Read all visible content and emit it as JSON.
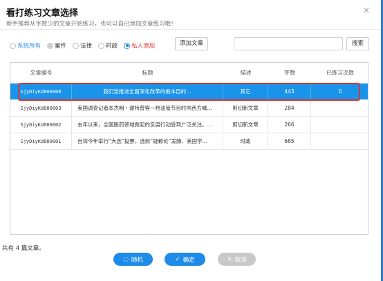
{
  "dialog": {
    "title": "看打练习文章选择",
    "subtitle": "新手推荐从字数少的文章开始练习，也可以自已添加文章练习哦！",
    "close_label": "×"
  },
  "filters": {
    "options": [
      {
        "label": "系统所有",
        "state": "selected-empty",
        "color": "#2f8fe6"
      },
      {
        "label": "案件",
        "state": "grey"
      },
      {
        "label": "法律",
        "state": "empty"
      },
      {
        "label": "时政",
        "state": "empty"
      },
      {
        "label": "私人添加",
        "state": "selected",
        "color": "#e23a3a"
      }
    ],
    "add_article_label": "添加文章",
    "search_placeholder": "",
    "search_value": "",
    "search_button_label": "搜索"
  },
  "table": {
    "headers": [
      "文章编号",
      "标题",
      "描述",
      "字数",
      "已练习次数"
    ],
    "rows": [
      {
        "id": "SjyDiyKd000008",
        "title": "我们党推进全面深化改革的根本目的…",
        "desc": "其它",
        "words": "443",
        "practiced": "0",
        "selected": true
      },
      {
        "id": "SjyDiyKd000003",
        "title": "美国调查记者本杰明・谢特曾客一档油管节目时向西方喊…",
        "desc": "剪切新文章",
        "words": "284",
        "practiced": "",
        "selected": false
      },
      {
        "id": "SjyDiyKd000002",
        "title": "去年以来，全国医药领域掀起的反腐行动受到广泛关注。…",
        "desc": "剪切新文章",
        "words": "266",
        "practiced": "",
        "selected": false
      },
      {
        "id": "SjyDiyKd000001",
        "title": "台湾今年举行“大选”投票，选前“疑赖论”发酵，美国学…",
        "desc": "时政",
        "words": "685",
        "practiced": "",
        "selected": false
      }
    ]
  },
  "footer": {
    "count_text": "共有 4 篇文章。",
    "random_label": "随机",
    "confirm_label": "确定",
    "cancel_label": "取消"
  },
  "colors": {
    "accent": "#1e8be8",
    "selected_row": "#1a93ea",
    "highlight_border": "#e0332d",
    "cancel_button": "#c9c9c9"
  }
}
